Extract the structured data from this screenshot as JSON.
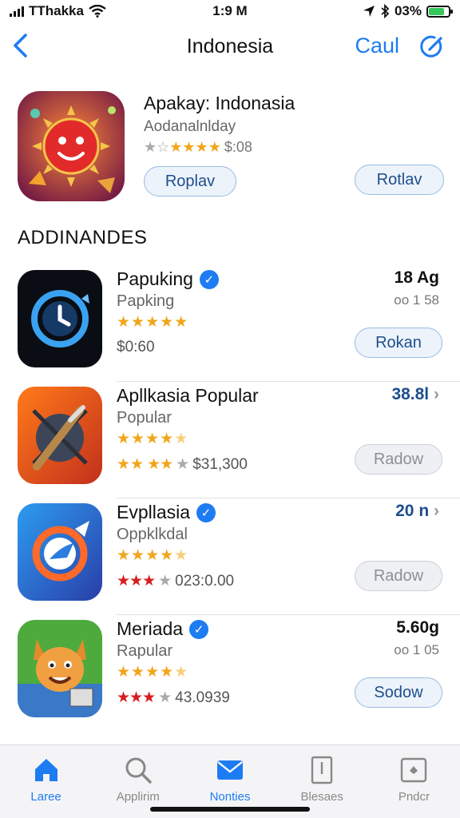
{
  "status_bar": {
    "carrier": "TThakka",
    "time": "1:9 M",
    "battery": "03%",
    "battery_level": 0.8
  },
  "nav": {
    "title": "Indonesia",
    "cancel_label": "Caul",
    "back_icon": "chevron-left-icon",
    "compose_icon": "compose-icon"
  },
  "featured": {
    "title": "Apakay: Indonasia",
    "subtitle": "Aodanalnlday",
    "rating_value": 4,
    "price": "$:08",
    "button_left": "Roplav",
    "button_right": "Rotlav"
  },
  "section_header": "ADDINANDES",
  "apps": [
    {
      "name": "Papuking",
      "verified": true,
      "category": "Papking",
      "stars": 5,
      "price": "$0:60",
      "size": "18 Ag",
      "time": "oo 1 58",
      "button": "Rokan",
      "button_style": "active",
      "accent": "#111111"
    },
    {
      "name": "Apllkasia Popular",
      "verified": false,
      "category": "Popular",
      "stars": 4.5,
      "price": "$31,300",
      "size": "38.8l",
      "time": "",
      "button": "Radow",
      "button_style": "disabled",
      "accent": "#1d4f8c"
    },
    {
      "name": "Evpllasia",
      "verified": true,
      "category": "Oppklkdal",
      "stars": 4.5,
      "price": "023:0.00",
      "size": "20 n",
      "time": "",
      "button": "Radow",
      "button_style": "disabled",
      "accent": "#1d4f8c"
    },
    {
      "name": "Meriada",
      "verified": true,
      "category": "Rapular",
      "stars": 4.5,
      "price": "43.0939",
      "size": "5.60g",
      "time": "oo 1 05",
      "button": "Sodow",
      "button_style": "active",
      "accent": "#111111"
    }
  ],
  "tabs": [
    {
      "label": "Laree",
      "icon": "home-icon",
      "active": true
    },
    {
      "label": "Applirim",
      "icon": "search-icon",
      "active": false
    },
    {
      "label": "Nonties",
      "icon": "mail-icon",
      "active": true
    },
    {
      "label": "Blesaes",
      "icon": "document-icon",
      "active": false
    },
    {
      "label": "Pndcr",
      "icon": "photo-icon",
      "active": false
    }
  ]
}
